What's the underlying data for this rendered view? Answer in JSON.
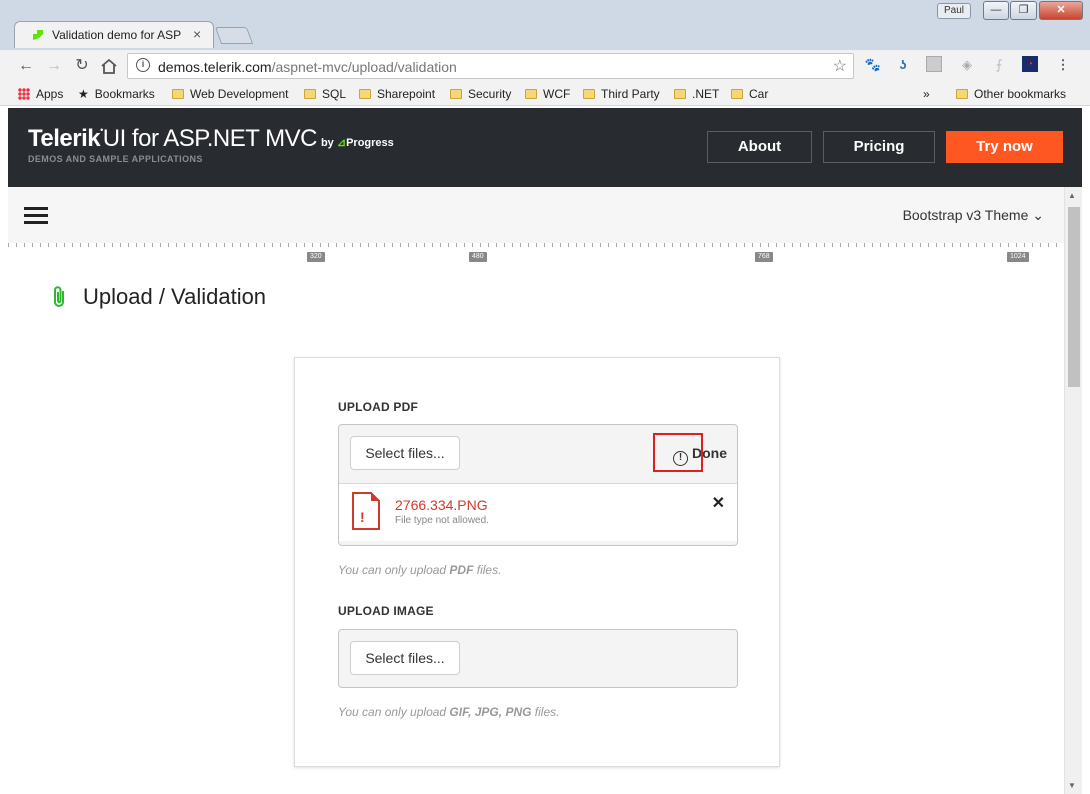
{
  "browser": {
    "tab_title": "Validation demo for ASP",
    "tab_close": "×",
    "profile": "Paul",
    "window_controls": {
      "minimize": "—",
      "maximize": "❐",
      "close": "✕"
    },
    "url_host": "demos.telerik.com",
    "url_path": "/aspnet-mvc/upload/validation",
    "bookmarks": {
      "apps": "Apps",
      "items": [
        "Bookmarks",
        "Web Development",
        "SQL",
        "Sharepoint",
        "Security",
        "WCF",
        "Third Party",
        ".NET",
        "Car"
      ],
      "overflow": "»",
      "other": "Other bookmarks"
    }
  },
  "header": {
    "brand_bold": "Telerik",
    "brand_rest": "UI for ASP.NET MVC",
    "brand_by": "by",
    "brand_progress": "Progress",
    "subtitle": "DEMOS AND SAMPLE APPLICATIONS",
    "about": "About",
    "pricing": "Pricing",
    "try_now": "Try now",
    "accent_color": "#ff5722"
  },
  "subnav": {
    "theme": "Bootstrap v3 Theme"
  },
  "ruler": {
    "marks": [
      "320",
      "480",
      "768",
      "1024"
    ]
  },
  "page": {
    "title": "Upload / Validation"
  },
  "upload_pdf": {
    "label": "UPLOAD PDF",
    "select_button": "Select files...",
    "status": "Done",
    "file": {
      "name": "2766.334.PNG",
      "error": "File type not allowed."
    },
    "hint_prefix": "You can only upload ",
    "hint_types": "PDF",
    "hint_suffix": " files."
  },
  "upload_image": {
    "label": "UPLOAD IMAGE",
    "select_button": "Select files...",
    "hint_prefix": "You can only upload ",
    "hint_types": "GIF, JPG, PNG",
    "hint_suffix": " files."
  }
}
